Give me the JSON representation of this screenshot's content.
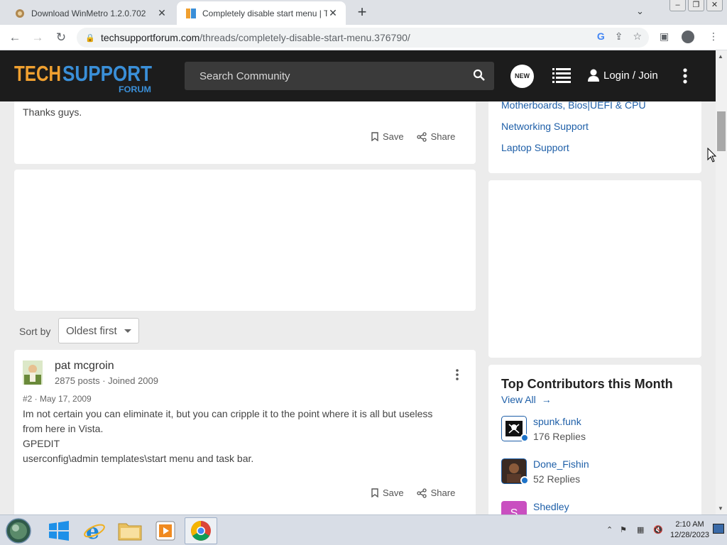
{
  "browser": {
    "tabs": [
      {
        "title": "Download WinMetro 1.2.0.702",
        "active": false
      },
      {
        "title": "Completely disable start menu | Tec",
        "active": true
      }
    ],
    "new_tab": "+",
    "url_host": "techsupportforum.com",
    "url_path": "/threads/completely-disable-start-menu.376790/"
  },
  "site": {
    "logo_top": "TECHSUPPORT",
    "logo_bottom": "FORUM",
    "search_placeholder": "Search Community",
    "new_badge": "NEW",
    "login_label": "Login / Join"
  },
  "first_post": {
    "text": "Thanks guys.",
    "save_label": "Save",
    "share_label": "Share"
  },
  "sort": {
    "label": "Sort by",
    "value": "Oldest first"
  },
  "reply": {
    "author": "pat mcgroin",
    "meta": "2875 posts · Joined 2009",
    "post_id": "#2 · May 17, 2009",
    "lines": [
      "Im not certain you can eliminate it, but you can cripple it to the point where it is all but useless",
      "from here in Vista.",
      "GPEDIT",
      "userconfig\\admin templates\\start menu and task bar."
    ],
    "save_label": "Save",
    "share_label": "Share"
  },
  "sidebar": {
    "forum_links": [
      "Motherboards, Bios|UEFI & CPU",
      "Networking Support",
      "Laptop Support"
    ],
    "top_title": "Top Contributors this Month",
    "view_all": "View All",
    "contributors": [
      {
        "name": "spunk.funk",
        "replies": "176 Replies",
        "color": "#ffffff"
      },
      {
        "name": "Done_Fishin",
        "replies": "52 Replies",
        "color": "#6b3a2a"
      },
      {
        "name": "Shedley",
        "replies": "",
        "color": "#c94fc0",
        "initial": "S"
      }
    ]
  },
  "taskbar": {
    "time": "2:10 AM",
    "date": "12/28/2023"
  },
  "colors": {
    "header_bg": "#1c1c1c",
    "logo_orange": "#f0a030",
    "logo_blue": "#3a8fd8",
    "link": "#1e5fa8"
  }
}
